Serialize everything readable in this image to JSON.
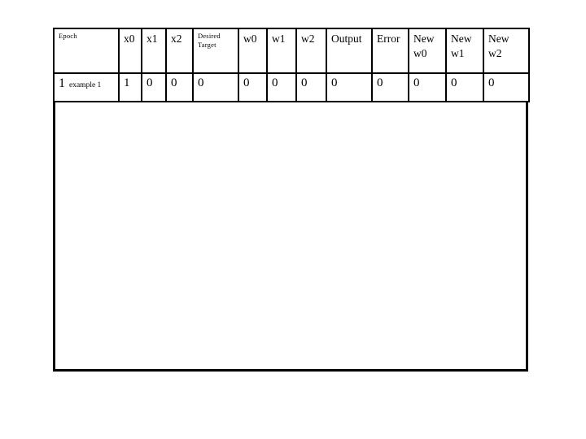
{
  "page": {
    "background_color": "#ffffff",
    "border_color": "#000000"
  },
  "table": {
    "columns": [
      {
        "key": "epoch",
        "label": "Epoch",
        "style": "tiny"
      },
      {
        "key": "x0",
        "label": "x0",
        "style": "normal"
      },
      {
        "key": "x1",
        "label": "x1",
        "style": "normal"
      },
      {
        "key": "x2",
        "label": "x2",
        "style": "normal"
      },
      {
        "key": "desired",
        "label_line1": "Desired",
        "label_line2": "Target",
        "style": "tiny-wrap"
      },
      {
        "key": "w0",
        "label": "w0",
        "style": "normal"
      },
      {
        "key": "w1",
        "label": "w1",
        "style": "normal"
      },
      {
        "key": "w2",
        "label": "w2",
        "style": "normal"
      },
      {
        "key": "output",
        "label": "Output",
        "style": "normal"
      },
      {
        "key": "error",
        "label": "Error",
        "style": "normal"
      },
      {
        "key": "new_w0",
        "label_line1": "New",
        "label_line2": "w0",
        "style": "wrap"
      },
      {
        "key": "new_w1",
        "label_line1": "New",
        "label_line2": "w1",
        "style": "wrap"
      },
      {
        "key": "new_w2",
        "label_line1": "New",
        "label_line2": "w2",
        "style": "wrap"
      }
    ],
    "rows": [
      {
        "epoch_number": "1",
        "epoch_example": "example 1",
        "x0": "1",
        "x1": "0",
        "x2": "0",
        "desired_target": "0",
        "w0": "0",
        "w1": "0",
        "w2": "0",
        "output": "0",
        "error": "0",
        "new_w0": "0",
        "new_w1": "0",
        "new_w2": "0"
      }
    ]
  }
}
